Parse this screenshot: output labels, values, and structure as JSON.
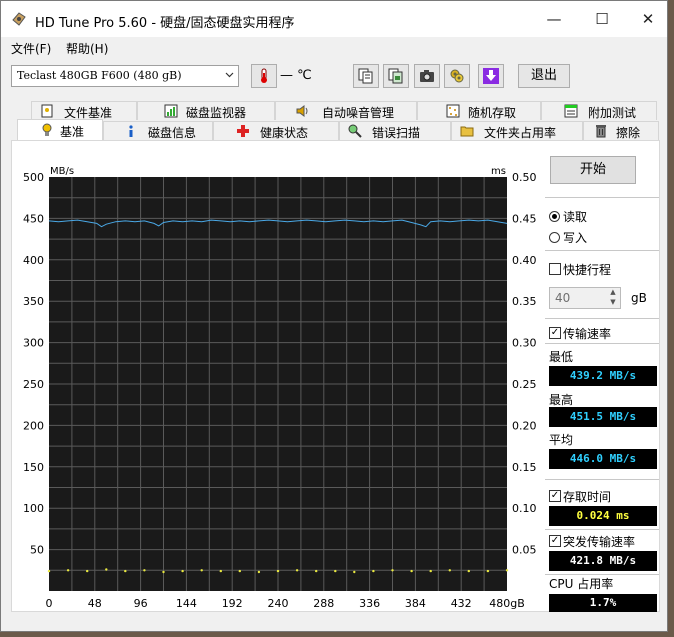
{
  "window": {
    "title": "HD Tune Pro 5.60 - 硬盘/固态硬盘实用程序",
    "controls": {
      "minimize": "—",
      "maximize": "☐",
      "close": "✕"
    }
  },
  "menu": {
    "file": "文件(F)",
    "help": "帮助(H)"
  },
  "toolbar": {
    "drive": "Teclast 480GB F600 (480 gB)",
    "temperature": "— ℃",
    "exit": "退出",
    "icons": [
      "thermometer-icon",
      "copy-text-icon",
      "copy-screenshot-icon",
      "camera-icon",
      "options-icon",
      "save-icon"
    ]
  },
  "tabs_top": [
    {
      "label": "文件基准",
      "icon": "file-benchmark-icon"
    },
    {
      "label": "磁盘监视器",
      "icon": "disk-monitor-icon"
    },
    {
      "label": "自动噪音管理",
      "icon": "speaker-icon"
    },
    {
      "label": "随机存取",
      "icon": "random-access-icon"
    },
    {
      "label": "附加测试",
      "icon": "extra-tests-icon"
    }
  ],
  "tabs_bottom": [
    {
      "label": "基准",
      "icon": "benchmark-icon",
      "active": true
    },
    {
      "label": "磁盘信息",
      "icon": "info-icon"
    },
    {
      "label": "健康状态",
      "icon": "health-icon"
    },
    {
      "label": "错误扫描",
      "icon": "error-scan-icon"
    },
    {
      "label": "文件夹占用率",
      "icon": "folder-usage-icon"
    },
    {
      "label": "擦除",
      "icon": "erase-icon"
    }
  ],
  "panel": {
    "start": "开始",
    "read": "读取",
    "write": "写入",
    "quick_stroke": "快捷行程",
    "quick_value": "40",
    "quick_unit": "gB",
    "transfer_rate": "传输速率",
    "min_label": "最低",
    "min_value": "439.2 MB/s",
    "max_label": "最高",
    "max_value": "451.5 MB/s",
    "avg_label": "平均",
    "avg_value": "446.0 MB/s",
    "access_time": "存取时间",
    "access_value": "0.024 ms",
    "burst_rate": "突发传输速率",
    "burst_value": "421.8 MB/s",
    "cpu_label": "CPU 占用率",
    "cpu_value": "1.7%"
  },
  "chart_data": {
    "type": "line",
    "y_left_label": "MB/s",
    "y_right_label": "ms",
    "y_left_ticks": [
      "500",
      "450",
      "400",
      "350",
      "300",
      "250",
      "200",
      "150",
      "100",
      "50"
    ],
    "y_right_ticks": [
      "0.50",
      "0.45",
      "0.40",
      "0.35",
      "0.30",
      "0.25",
      "0.20",
      "0.15",
      "0.10",
      "0.05"
    ],
    "x_ticks": [
      "0",
      "48",
      "96",
      "144",
      "192",
      "240",
      "288",
      "336",
      "384",
      "432",
      "480gB"
    ],
    "xlim": [
      0,
      480
    ],
    "ylim_left": [
      0,
      500
    ],
    "ylim_right": [
      0,
      0.5
    ],
    "grid": true,
    "series": [
      {
        "color": "#4aa8e6",
        "x": [
          0,
          10,
          20,
          30,
          40,
          50,
          55,
          60,
          70,
          80,
          90,
          100,
          110,
          115,
          120,
          130,
          140,
          150,
          160,
          170,
          180,
          190,
          200,
          210,
          220,
          230,
          240,
          250,
          260,
          270,
          280,
          290,
          300,
          310,
          320,
          330,
          340,
          350,
          360,
          370,
          380,
          390,
          395,
          400,
          410,
          420,
          430,
          440,
          450,
          460,
          470,
          480
        ],
        "y": [
          447,
          446,
          447,
          448,
          446,
          444,
          440,
          443,
          446,
          447,
          446,
          447,
          444,
          441,
          445,
          447,
          446,
          447,
          446,
          448,
          447,
          446,
          447,
          446,
          447,
          448,
          447,
          446,
          447,
          448,
          447,
          446,
          447,
          448,
          447,
          446,
          447,
          446,
          447,
          448,
          445,
          442,
          440,
          446,
          447,
          446,
          447,
          448,
          447,
          448,
          446,
          444
        ]
      },
      {
        "color": "#e8e840",
        "x": [
          0,
          20,
          40,
          60,
          80,
          100,
          120,
          140,
          160,
          180,
          200,
          220,
          240,
          260,
          280,
          300,
          320,
          340,
          360,
          380,
          400,
          420,
          440,
          460,
          480
        ],
        "y_ms": [
          0.024,
          0.025,
          0.024,
          0.026,
          0.024,
          0.025,
          0.023,
          0.024,
          0.025,
          0.024,
          0.024,
          0.023,
          0.024,
          0.025,
          0.024,
          0.024,
          0.023,
          0.024,
          0.025,
          0.024,
          0.024,
          0.025,
          0.024,
          0.024,
          0.025
        ]
      }
    ]
  }
}
